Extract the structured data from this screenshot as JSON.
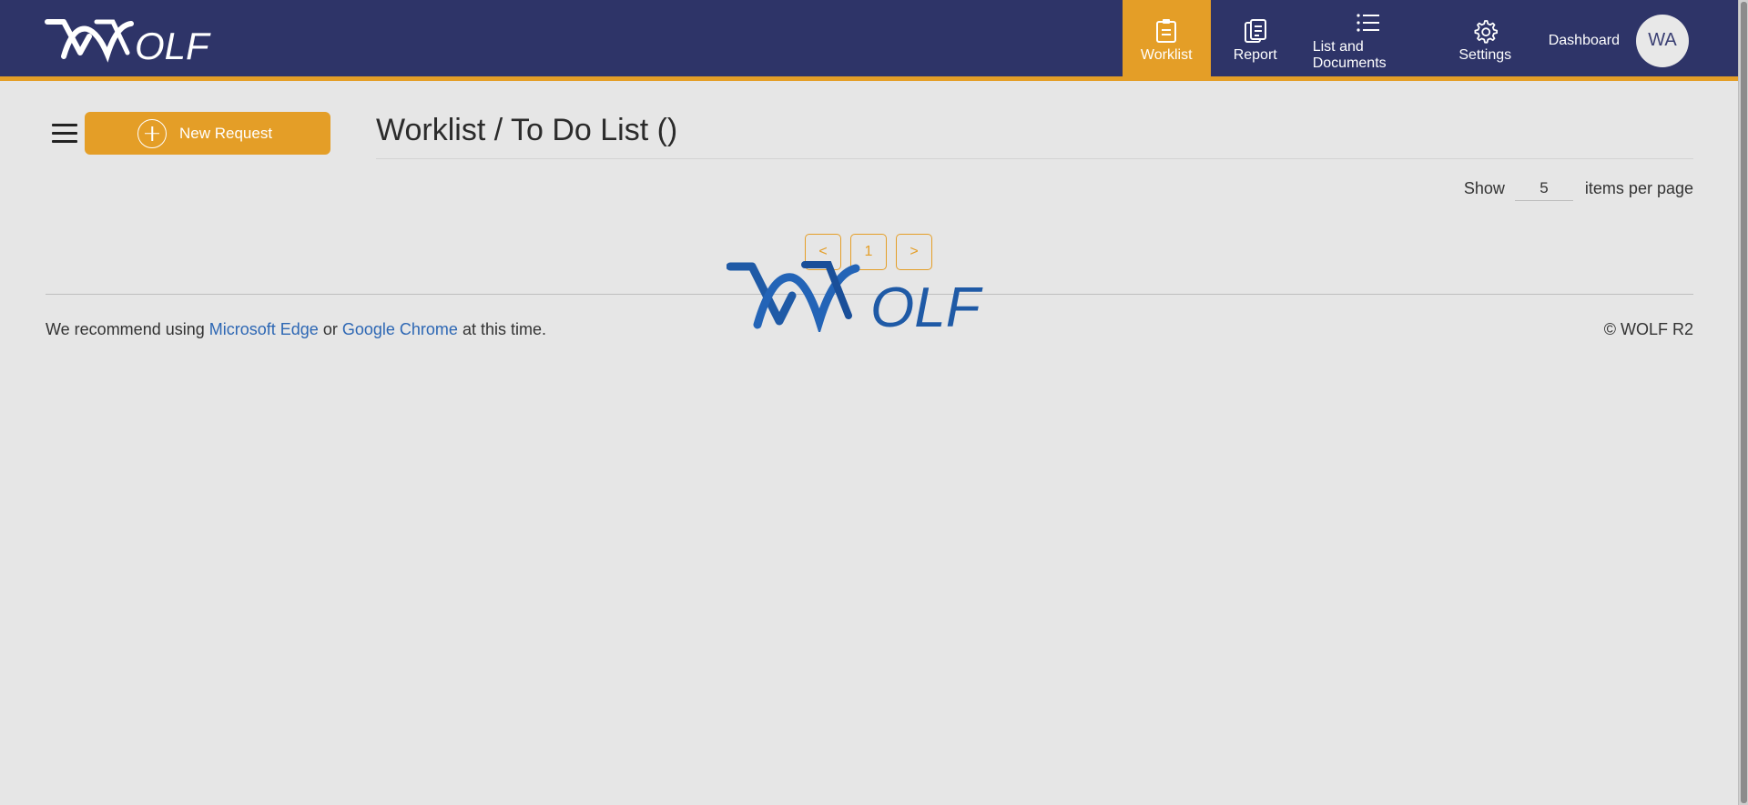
{
  "brand": {
    "logo_text": "WOLF"
  },
  "nav": {
    "items": [
      {
        "label": "Worklist",
        "icon": "clipboard-icon",
        "active": true
      },
      {
        "label": "Report",
        "icon": "report-icon",
        "active": false
      },
      {
        "label": "List and Documents",
        "icon": "list-icon",
        "active": false
      },
      {
        "label": "Settings",
        "icon": "gear-icon",
        "active": false
      },
      {
        "label": "Dashboard",
        "active": false
      }
    ],
    "avatar_initials": "WA"
  },
  "toolbar": {
    "new_request_label": "New Request"
  },
  "page": {
    "title": "Worklist / To Do List ()"
  },
  "pagination": {
    "show_label": "Show",
    "items_per_page": "5",
    "items_per_page_label": "items per page",
    "prev": "<",
    "current_page": "1",
    "next": ">"
  },
  "loading": {
    "logo_text": "WOLF"
  },
  "footer": {
    "recommend_prefix": "We recommend using",
    "edge_link": "Microsoft Edge",
    "or": "or",
    "chrome_link": "Google Chrome",
    "suffix": "at this time.",
    "copyright": "© WOLF R2"
  },
  "colors": {
    "header_bg": "#2e3468",
    "accent": "#e49e27",
    "link": "#2d67b4",
    "background": "#e6e6e6"
  }
}
